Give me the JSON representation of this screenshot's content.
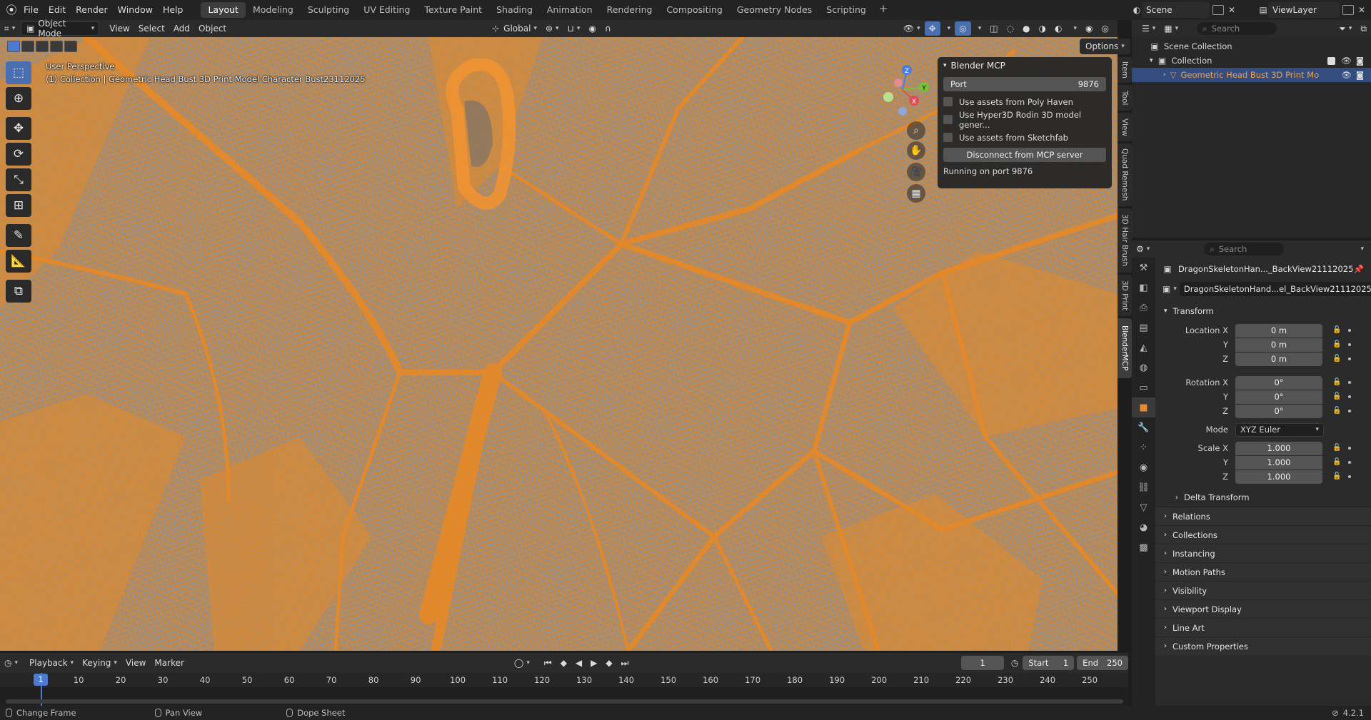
{
  "topbar": {
    "menus": [
      "File",
      "Edit",
      "Render",
      "Window",
      "Help"
    ],
    "workspaces": [
      "Layout",
      "Modeling",
      "Sculpting",
      "UV Editing",
      "Texture Paint",
      "Shading",
      "Animation",
      "Rendering",
      "Compositing",
      "Geometry Nodes",
      "Scripting"
    ],
    "active_workspace": "Layout",
    "scene": "Scene",
    "view_layer": "ViewLayer"
  },
  "viewport_header": {
    "mode": "Object Mode",
    "menus": [
      "View",
      "Select",
      "Add",
      "Object"
    ],
    "transform_orientation": "Global",
    "options": "Options"
  },
  "viewport": {
    "perspective_label": "User Perspective",
    "object_info": "(1) Collection | Geometric Head Bust 3D Print Model Character Bust23112025",
    "gizmo": {
      "x": "X",
      "y": "Y",
      "z": "Z"
    },
    "mesh_color": "#e0892b",
    "background_color": "#8a8d92"
  },
  "mcp_panel": {
    "title": "Blender MCP",
    "port_label": "Port",
    "port_value": "9876",
    "checks": [
      "Use assets from Poly Haven",
      "Use Hyper3D Rodin 3D model gener...",
      "Use assets from Sketchfab"
    ],
    "disconnect": "Disconnect from MCP server",
    "status": "Running on port 9876"
  },
  "n_tabs": [
    "Item",
    "Tool",
    "View",
    "Quad Remesh",
    "3D Hair Brush",
    "3D Print",
    "BlenderMCP"
  ],
  "timeline": {
    "menus": [
      "Playback",
      "Keying",
      "View",
      "Marker"
    ],
    "current_frame": "1",
    "start_label": "Start",
    "start": "1",
    "end_label": "End",
    "end": "250",
    "ticks": [
      "10",
      "20",
      "30",
      "40",
      "50",
      "60",
      "70",
      "80",
      "90",
      "100",
      "110",
      "120",
      "130",
      "140",
      "150",
      "160",
      "170",
      "180",
      "190",
      "200",
      "210",
      "220",
      "230",
      "240",
      "250"
    ],
    "playhead": "1"
  },
  "statusbar": {
    "items": [
      "Change Frame",
      "Pan View",
      "Dope Sheet"
    ],
    "version": "4.2.1"
  },
  "outliner": {
    "search_placeholder": "Search",
    "scene_collection": "Scene Collection",
    "collection": "Collection",
    "object": "Geometric Head Bust 3D Print Mo"
  },
  "properties": {
    "search_placeholder": "Search",
    "object_name": "DragonSkeletonHan..._BackView21112025",
    "data_name": "DragonSkeletonHand...el_BackView21112025",
    "transform_title": "Transform",
    "location": {
      "label": "Location X",
      "x": "0 m",
      "y": "0 m",
      "z": "0 m"
    },
    "rotation": {
      "label": "Rotation X",
      "x": "0°",
      "y": "0°",
      "z": "0°"
    },
    "mode_label": "Mode",
    "mode_value": "XYZ Euler",
    "scale": {
      "label": "Scale X",
      "x": "1.000",
      "y": "1.000",
      "z": "1.000"
    },
    "axis": {
      "y": "Y",
      "z": "Z"
    },
    "delta": "Delta Transform",
    "sections": [
      "Relations",
      "Collections",
      "Instancing",
      "Motion Paths",
      "Visibility",
      "Viewport Display",
      "Line Art",
      "Custom Properties"
    ]
  }
}
